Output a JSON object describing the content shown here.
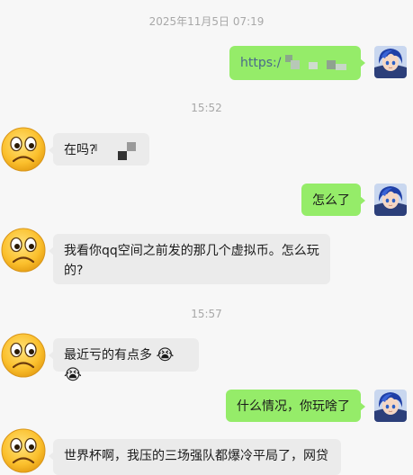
{
  "chat": {
    "timestamps": [
      "2025年11月5日 07:19",
      "15:52",
      "15:57"
    ],
    "messages": [
      {
        "side": "right",
        "text": "https:/"
      },
      {
        "side": "left",
        "text": "在吗?"
      },
      {
        "side": "right",
        "text": "怎么了"
      },
      {
        "side": "left",
        "text": "我看你qq空间之前发的那几个虚拟币。怎么玩的?"
      },
      {
        "side": "left",
        "text": "最近亏的有点多",
        "emojis": [
          "😭",
          "😭"
        ]
      },
      {
        "side": "right",
        "text": "什么情况，你玩啥了"
      },
      {
        "side": "left",
        "text": "世界杯啊，我压的三场强队都爆冷平局了，网贷"
      }
    ]
  },
  "colors": {
    "background": "#f7f7f7",
    "left_bubble": "#ebebeb",
    "right_bubble": "#95ec69",
    "timestamp": "#a8a8a8"
  },
  "icons": {
    "contact_avatar": "frowning-face-emoji-avatar",
    "self_avatar": "anime-character-avatar"
  }
}
